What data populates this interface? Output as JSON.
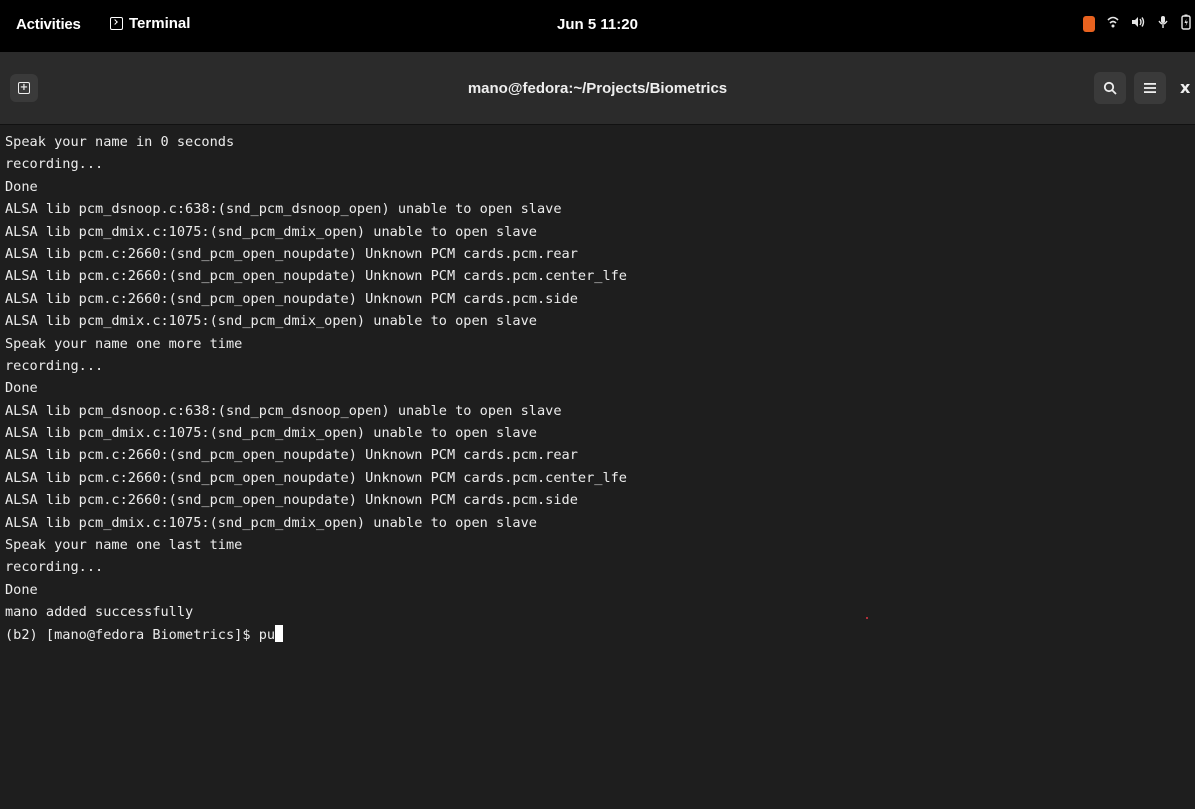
{
  "topbar": {
    "activities": "Activities",
    "app_name": "Terminal",
    "clock": "Jun 5 11:20",
    "tray_icons": [
      "notification-indicator",
      "wifi-icon",
      "volume-icon",
      "microphone-icon",
      "battery-icon"
    ],
    "indicator_color": "#e8621f"
  },
  "window": {
    "title": "mano@fedora:~/Projects/Biometrics",
    "buttons": {
      "new_tab": "new-tab-icon",
      "search": "search-icon",
      "menu": "hamburger-menu-icon",
      "close": "x"
    }
  },
  "terminal": {
    "lines": [
      "Speak your name in 0 seconds",
      "recording...",
      "Done",
      "ALSA lib pcm_dsnoop.c:638:(snd_pcm_dsnoop_open) unable to open slave",
      "ALSA lib pcm_dmix.c:1075:(snd_pcm_dmix_open) unable to open slave",
      "ALSA lib pcm.c:2660:(snd_pcm_open_noupdate) Unknown PCM cards.pcm.rear",
      "ALSA lib pcm.c:2660:(snd_pcm_open_noupdate) Unknown PCM cards.pcm.center_lfe",
      "ALSA lib pcm.c:2660:(snd_pcm_open_noupdate) Unknown PCM cards.pcm.side",
      "ALSA lib pcm_dmix.c:1075:(snd_pcm_dmix_open) unable to open slave",
      "Speak your name one more time",
      "recording...",
      "Done",
      "ALSA lib pcm_dsnoop.c:638:(snd_pcm_dsnoop_open) unable to open slave",
      "ALSA lib pcm_dmix.c:1075:(snd_pcm_dmix_open) unable to open slave",
      "ALSA lib pcm.c:2660:(snd_pcm_open_noupdate) Unknown PCM cards.pcm.rear",
      "ALSA lib pcm.c:2660:(snd_pcm_open_noupdate) Unknown PCM cards.pcm.center_lfe",
      "ALSA lib pcm.c:2660:(snd_pcm_open_noupdate) Unknown PCM cards.pcm.side",
      "ALSA lib pcm_dmix.c:1075:(snd_pcm_dmix_open) unable to open slave",
      "Speak your name one last time",
      "recording...",
      "Done",
      "mano added successfully"
    ],
    "prompt": "(b2) [mano@fedora Biometrics]$ ",
    "current_input": "pu",
    "background": "#1e1e1e",
    "foreground": "#ececec"
  }
}
